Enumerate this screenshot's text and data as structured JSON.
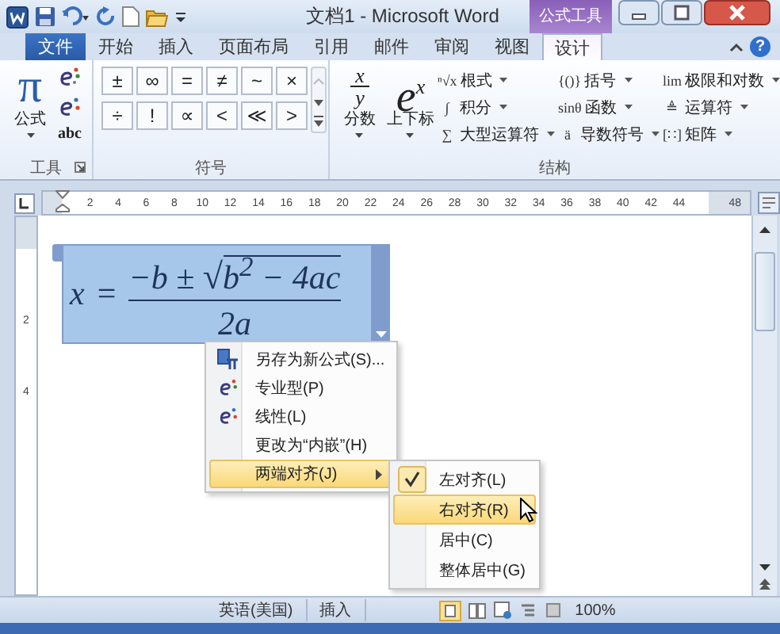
{
  "window": {
    "title": "文档1 - Microsoft Word",
    "contextual_tab": "公式工具"
  },
  "tabs": [
    {
      "label": "文件",
      "kind": "file",
      "selected": false
    },
    {
      "label": "开始",
      "kind": "normal",
      "selected": false
    },
    {
      "label": "插入",
      "kind": "normal",
      "selected": false
    },
    {
      "label": "页面布局",
      "kind": "normal",
      "selected": false
    },
    {
      "label": "引用",
      "kind": "normal",
      "selected": false
    },
    {
      "label": "邮件",
      "kind": "normal",
      "selected": false
    },
    {
      "label": "审阅",
      "kind": "normal",
      "selected": false
    },
    {
      "label": "视图",
      "kind": "normal",
      "selected": false
    },
    {
      "label": "设计",
      "kind": "contextual",
      "selected": true
    }
  ],
  "help": "?",
  "tools_group": {
    "label": "工具",
    "big_button": {
      "glyph": "π",
      "label": "公式"
    },
    "text_button": "abc"
  },
  "symbols_group": {
    "label": "符号",
    "symbols": [
      "±",
      "∞",
      "=",
      "≠",
      "~",
      "×",
      "÷",
      "!",
      "∝",
      "<",
      "≪",
      ">"
    ]
  },
  "structures_group": {
    "label": "结构",
    "big_buttons": [
      {
        "kind": "fraction",
        "glyph": [
          "x",
          "y"
        ],
        "label": "分数"
      },
      {
        "kind": "script",
        "glyph": [
          "e",
          "x"
        ],
        "label": "上下标"
      }
    ],
    "items": [
      {
        "glyph": "ⁿ√x",
        "label": "根式"
      },
      {
        "glyph": "∫",
        "label": "积分"
      },
      {
        "glyph": "∑",
        "label": "大型运算符"
      },
      {
        "glyph": "{()}",
        "label": "括号"
      },
      {
        "glyph": "sinθ",
        "label": "函数"
      },
      {
        "glyph": "ä",
        "label": "导数符号"
      },
      {
        "glyph": "lim",
        "label": "极限和对数"
      },
      {
        "glyph": "≜",
        "label": "运算符"
      },
      {
        "glyph": "[∷]",
        "label": "矩阵"
      }
    ]
  },
  "ruler": {
    "marks": [
      "2",
      "4",
      "6",
      "8",
      "10",
      "12",
      "14",
      "16",
      "18",
      "20",
      "22",
      "24",
      "26",
      "28",
      "30",
      "32",
      "34",
      "36",
      "38",
      "40",
      "42",
      "44",
      "48"
    ]
  },
  "vertical_ruler": [
    "2",
    "4"
  ],
  "equation": {
    "lhs": "x",
    "relation": "=",
    "numerator": "−b ±",
    "radical": "√",
    "radicand": "b$^{2}$ − 4ac",
    "denominator": "2a"
  },
  "context_menu": [
    {
      "label": "另存为新公式(S)...",
      "kind": "save",
      "selected": false,
      "submenu": false
    },
    {
      "label": "专业型(P)",
      "kind": "professional",
      "selected": false,
      "submenu": false
    },
    {
      "label": "线性(L)",
      "kind": "linear",
      "selected": false,
      "submenu": false
    },
    {
      "label": "更改为“内嵌”(H)",
      "kind": "plain",
      "selected": false,
      "submenu": false
    },
    {
      "label": "两端对齐(J)",
      "kind": "plain",
      "selected": true,
      "submenu": true
    }
  ],
  "submenu": [
    {
      "label": "左对齐(L)",
      "checked": true,
      "selected": false
    },
    {
      "label": "右对齐(R)",
      "checked": false,
      "selected": true
    },
    {
      "label": "居中(C)",
      "checked": false,
      "selected": false
    },
    {
      "label": "整体居中(G)",
      "checked": false,
      "selected": false
    }
  ],
  "status_bar": {
    "items": [
      "英语(美国)",
      "插入"
    ],
    "zoom": "100%"
  }
}
